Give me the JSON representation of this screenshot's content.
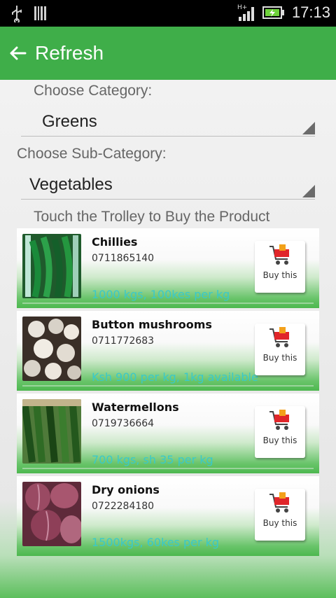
{
  "status_bar": {
    "time": "17:13",
    "network": "H+"
  },
  "app_bar": {
    "title": "Refresh"
  },
  "category": {
    "label": "Choose Category:",
    "value": "Greens"
  },
  "sub_category": {
    "label": "Choose Sub-Category:",
    "value": "Vegetables"
  },
  "instruction": "Touch the Trolley to Buy the Product",
  "products": [
    {
      "name": "Chillies",
      "phone": "0711865140",
      "desc": "1000 kgs, 100kes per kg",
      "buy_label": "Buy this"
    },
    {
      "name": "Button mushrooms",
      "phone": "0711772683",
      "desc": "Ksh 900 per kg, 1kg available",
      "buy_label": "Buy this"
    },
    {
      "name": "Watermellons",
      "phone": "0719736664",
      "desc": "700 kgs, sh 35 per kg",
      "buy_label": "Buy this"
    },
    {
      "name": "Dry onions",
      "phone": "0722284180",
      "desc": "1500kgs, 60kes per kg",
      "buy_label": "Buy this"
    }
  ],
  "colors": {
    "app_bar": "#3fae49",
    "desc_text": "#3ac9c9",
    "gradient_green": "#4db84f"
  }
}
